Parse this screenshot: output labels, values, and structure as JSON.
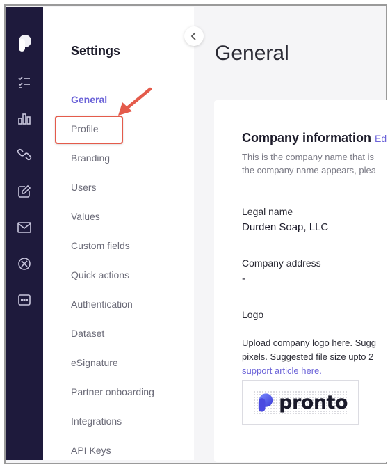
{
  "settings_panel": {
    "title": "Settings",
    "items": [
      {
        "label": "General",
        "active": true
      },
      {
        "label": "Profile",
        "active": false
      },
      {
        "label": "Branding",
        "active": false
      },
      {
        "label": "Users",
        "active": false
      },
      {
        "label": "Values",
        "active": false
      },
      {
        "label": "Custom fields",
        "active": false
      },
      {
        "label": "Quick actions",
        "active": false
      },
      {
        "label": "Authentication",
        "active": false
      },
      {
        "label": "Dataset",
        "active": false
      },
      {
        "label": "eSignature",
        "active": false
      },
      {
        "label": "Partner onboarding",
        "active": false
      },
      {
        "label": "Integrations",
        "active": false
      },
      {
        "label": "API Keys",
        "active": false
      }
    ]
  },
  "rail_icons": [
    "app-logo-icon",
    "tasks-checklist-icon",
    "bar-chart-icon",
    "link-icon",
    "edit-note-icon",
    "mail-icon",
    "compass-icon",
    "more-dots-icon"
  ],
  "main": {
    "title": "General",
    "company_info": {
      "heading": "Company information",
      "edit_label": "Ed",
      "description_line1": "This is the company name that is",
      "description_line2": "the company name appears, plea",
      "legal_name_label": "Legal name",
      "legal_name_value": "Durden Soap, LLC",
      "address_label": "Company address",
      "address_value": "-",
      "logo_label": "Logo",
      "logo_desc_line1": "Upload company logo here. Sugg",
      "logo_desc_line2": "pixels. Suggested file size upto 2",
      "support_link": "support article here.",
      "logo_wordmark": "pronto"
    }
  },
  "colors": {
    "accent": "#6b63d8",
    "rail_bg": "#1e1a3c",
    "annotation": "#e45b4b"
  }
}
